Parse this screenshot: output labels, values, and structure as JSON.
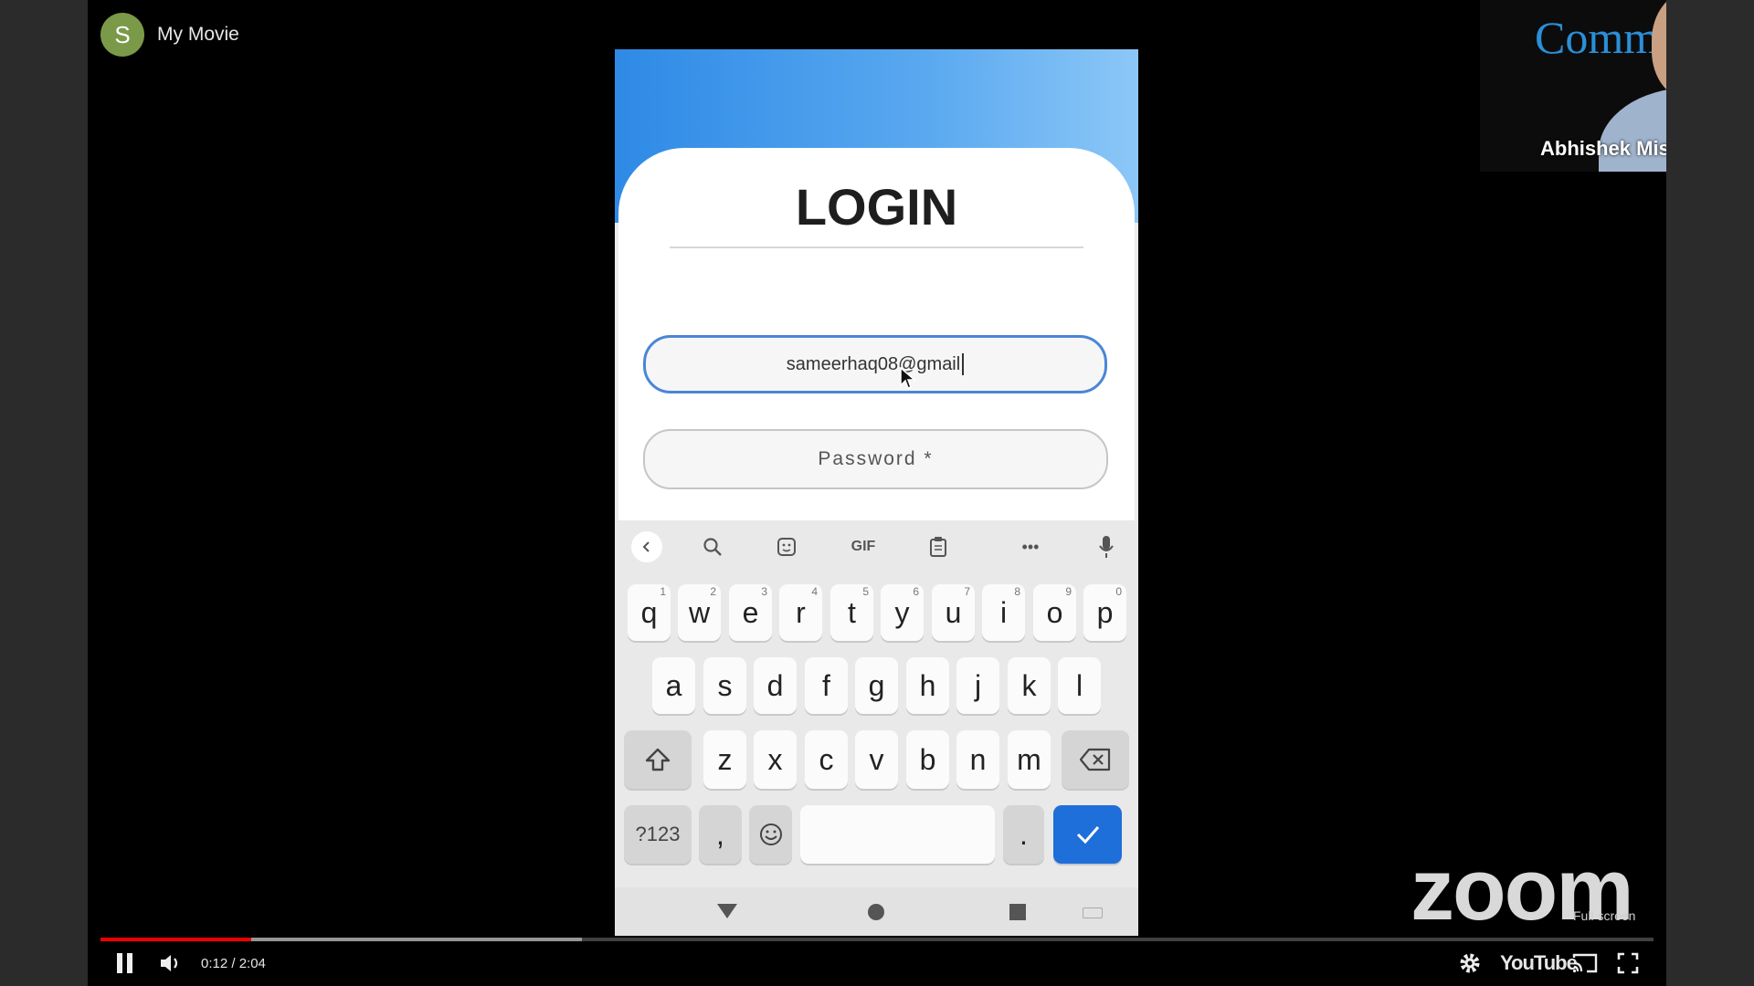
{
  "channel": {
    "avatar_letter": "S",
    "title": "My Movie"
  },
  "phone": {
    "title": "LOGIN",
    "email_value": "sameerhaq08@gmail",
    "password_placeholder": "Password *",
    "toolbar": {
      "gif_label": "GIF",
      "more_label": "•••"
    },
    "keyboard": {
      "row1": [
        {
          "key": "q",
          "hint": "1"
        },
        {
          "key": "w",
          "hint": "2"
        },
        {
          "key": "e",
          "hint": "3"
        },
        {
          "key": "r",
          "hint": "4"
        },
        {
          "key": "t",
          "hint": "5"
        },
        {
          "key": "y",
          "hint": "6"
        },
        {
          "key": "u",
          "hint": "7"
        },
        {
          "key": "i",
          "hint": "8"
        },
        {
          "key": "o",
          "hint": "9"
        },
        {
          "key": "p",
          "hint": "0"
        }
      ],
      "row2": [
        "a",
        "s",
        "d",
        "f",
        "g",
        "h",
        "j",
        "k",
        "l"
      ],
      "row3": [
        "z",
        "x",
        "c",
        "v",
        "b",
        "n",
        "m"
      ],
      "symbols_label": "?123",
      "comma_label": ",",
      "period_label": "."
    }
  },
  "webcam": {
    "logo_text": "Commodity",
    "participant_name": "Abhishek Mish..."
  },
  "watermark": {
    "brand": "zoom",
    "tooltip": "Full screen"
  },
  "player": {
    "time_display": "0:12 / 2:04",
    "played_fraction": 0.097,
    "buffered_fraction": 0.31,
    "youtube_label": "YouTube",
    "accent_color": "#ee0000"
  },
  "icons": [
    "pause-icon",
    "volume-icon",
    "settings-icon",
    "cast-icon",
    "fullscreen-icon",
    "search-icon",
    "microphone-icon",
    "emoji-icon",
    "backspace-icon",
    "shift-icon",
    "check-icon"
  ]
}
